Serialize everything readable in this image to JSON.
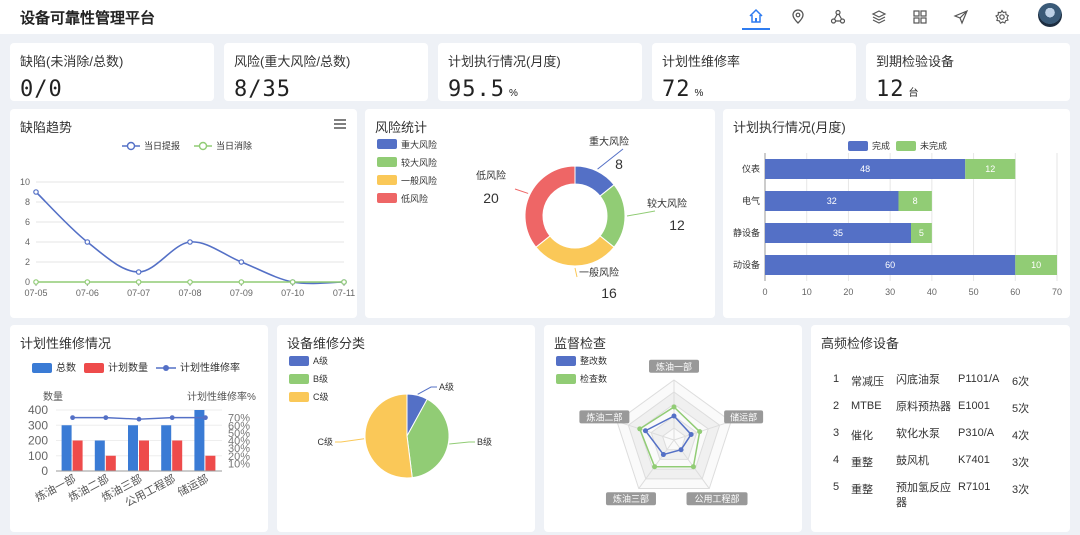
{
  "app": {
    "title": "设备可靠性管理平台"
  },
  "nav": {
    "icons": [
      "home-icon",
      "map-pin-icon",
      "network-icon",
      "layers-icon",
      "grid-icon",
      "send-icon",
      "gear-icon"
    ]
  },
  "kpis": [
    {
      "label": "缺陷(未消除/总数)",
      "value": "0/0",
      "unit": ""
    },
    {
      "label": "风险(重大风险/总数)",
      "value": "8/35",
      "unit": ""
    },
    {
      "label": "计划执行情况(月度)",
      "value": "95.5",
      "unit": "%"
    },
    {
      "label": "计划性维修率",
      "value": "72",
      "unit": "%"
    },
    {
      "label": "到期检验设备",
      "value": "12",
      "unit": "台"
    }
  ],
  "defect_trend": {
    "title": "缺陷趋势",
    "chart_data": {
      "type": "line",
      "x": [
        "07-05",
        "07-06",
        "07-07",
        "07-08",
        "07-09",
        "07-10",
        "07-11"
      ],
      "series": [
        {
          "name": "当日提报",
          "values": [
            9,
            4,
            1,
            4,
            2,
            0,
            0
          ],
          "color": "#5470c6"
        },
        {
          "name": "当日消除",
          "values": [
            0,
            0,
            0,
            0,
            0,
            0,
            0
          ],
          "color": "#91cc75"
        }
      ],
      "ylim": [
        0,
        10
      ],
      "yticks": [
        0,
        2,
        4,
        6,
        8,
        10
      ],
      "grid": true,
      "legend": "top-center"
    }
  },
  "risk_stats": {
    "title": "风险统计",
    "chart_data": {
      "type": "pie",
      "donut": true,
      "slices": [
        {
          "name": "重大风险",
          "value": 8,
          "color": "#5470c6"
        },
        {
          "name": "较大风险",
          "value": 12,
          "color": "#91cc75"
        },
        {
          "name": "一般风险",
          "value": 16,
          "color": "#fac858"
        },
        {
          "name": "低风险",
          "value": 20,
          "color": "#ee6666"
        }
      ],
      "legend": "top-left"
    }
  },
  "plan_exec": {
    "title": "计划执行情况(月度)",
    "chart_data": {
      "type": "bar",
      "orientation": "horizontal",
      "stacked": true,
      "categories": [
        "仪表",
        "电气",
        "静设备",
        "动设备"
      ],
      "series": [
        {
          "name": "完成",
          "values": [
            48,
            32,
            35,
            60
          ],
          "color": "#5470c6"
        },
        {
          "name": "未完成",
          "values": [
            12,
            8,
            5,
            10
          ],
          "color": "#91cc75"
        }
      ],
      "xlim": [
        0,
        70
      ],
      "xticks": [
        0,
        10,
        20,
        30,
        40,
        50,
        60,
        70
      ],
      "legend": "top-center"
    }
  },
  "planned_maint": {
    "title": "计划性维修情况",
    "chart_data": {
      "type": "bar",
      "categories": [
        "炼油一部",
        "炼油二部",
        "炼油三部",
        "公用工程部",
        "储运部"
      ],
      "series": [
        {
          "name": "总数",
          "values": [
            300,
            200,
            300,
            300,
            400
          ],
          "color": "#3a7bd5"
        },
        {
          "name": "计划数量",
          "values": [
            200,
            100,
            200,
            200,
            100
          ],
          "color": "#ee4b4b"
        },
        {
          "name": "计划性维修率",
          "values": [
            70,
            70,
            68,
            70,
            70
          ],
          "color": "#5470c6",
          "type": "line"
        }
      ],
      "ylabel": "数量",
      "ylabel_right": "计划性维修率%",
      "ylim": [
        0,
        400
      ],
      "yticks": [
        0,
        100,
        200,
        300,
        400
      ],
      "y2lim": [
        0,
        80
      ],
      "y2ticks": [
        "10%",
        "20%",
        "30%",
        "40%",
        "50%",
        "60%",
        "70%"
      ],
      "legend": "top-center"
    }
  },
  "equip_class": {
    "title": "设备维修分类",
    "chart_data": {
      "type": "pie",
      "slices": [
        {
          "name": "A级",
          "value": 8,
          "color": "#5470c6"
        },
        {
          "name": "B级",
          "value": 40,
          "color": "#91cc75"
        },
        {
          "name": "C级",
          "value": 52,
          "color": "#fac858"
        }
      ],
      "legend": "top-left"
    }
  },
  "inspection": {
    "title": "监督检查",
    "chart_data": {
      "type": "radar",
      "indicators": [
        "炼油一部",
        "储运部",
        "公用工程部",
        "炼油三部",
        "炼油二部"
      ],
      "series": [
        {
          "name": "整改数",
          "values": [
            40,
            30,
            20,
            30,
            50
          ],
          "color": "#5470c6"
        },
        {
          "name": "检查数",
          "values": [
            55,
            45,
            55,
            55,
            60
          ],
          "color": "#91cc75"
        }
      ],
      "legend": "top-left"
    }
  },
  "high_freq": {
    "title": "高频检修设备",
    "rows": [
      {
        "rank": "1",
        "unit": "常减压",
        "name": "闪底油泵",
        "tag": "P1101/A",
        "count": "6次"
      },
      {
        "rank": "2",
        "unit": "MTBE",
        "name": "原料预热器",
        "tag": "E1001",
        "count": "5次"
      },
      {
        "rank": "3",
        "unit": "催化",
        "name": "软化水泵",
        "tag": "P310/A",
        "count": "4次"
      },
      {
        "rank": "4",
        "unit": "重整",
        "name": "鼓风机",
        "tag": "K7401",
        "count": "3次"
      },
      {
        "rank": "5",
        "unit": "重整",
        "name": "预加氢反应器",
        "tag": "R7101",
        "count": "3次"
      }
    ]
  }
}
